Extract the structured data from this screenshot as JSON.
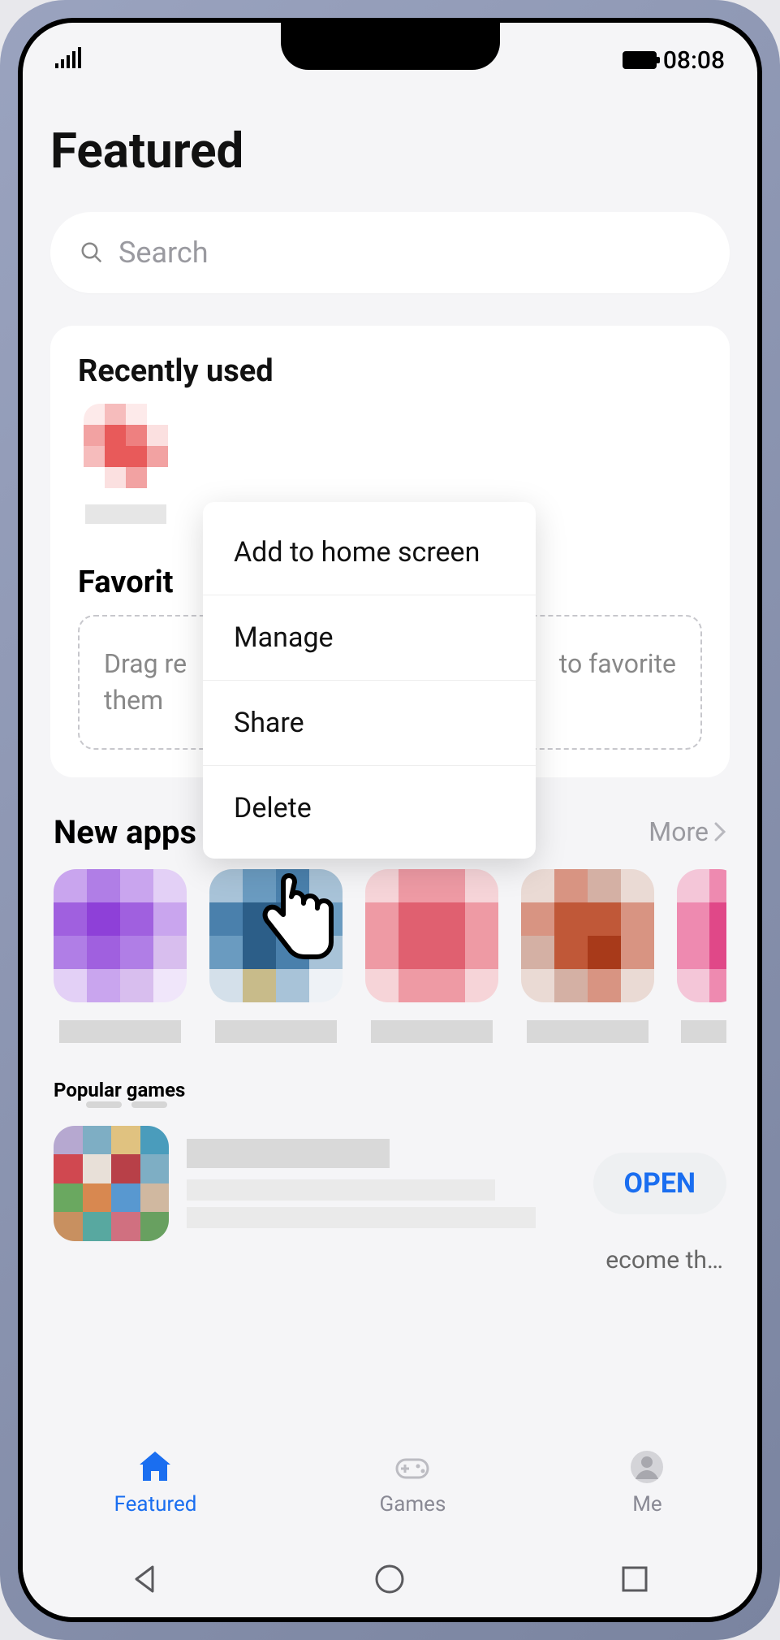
{
  "status_bar": {
    "time": "08:08"
  },
  "page_title": "Featured",
  "search": {
    "placeholder": "Search"
  },
  "recently_used": {
    "title": "Recently used",
    "context_menu": {
      "add_home": "Add to home screen",
      "manage": "Manage",
      "share": "Share",
      "delete": "Delete"
    }
  },
  "favorites": {
    "title_visible": "Favorit",
    "hint_left": "Drag re",
    "hint_right": "to favorite",
    "hint_bottom": "them"
  },
  "new_apps": {
    "title": "New apps we love",
    "more_label": "More"
  },
  "popular": {
    "title": "Popular games",
    "open_label": "OPEN",
    "desc_visible": "ecome th…"
  },
  "nav": {
    "featured": "Featured",
    "games": "Games",
    "me": "Me"
  }
}
